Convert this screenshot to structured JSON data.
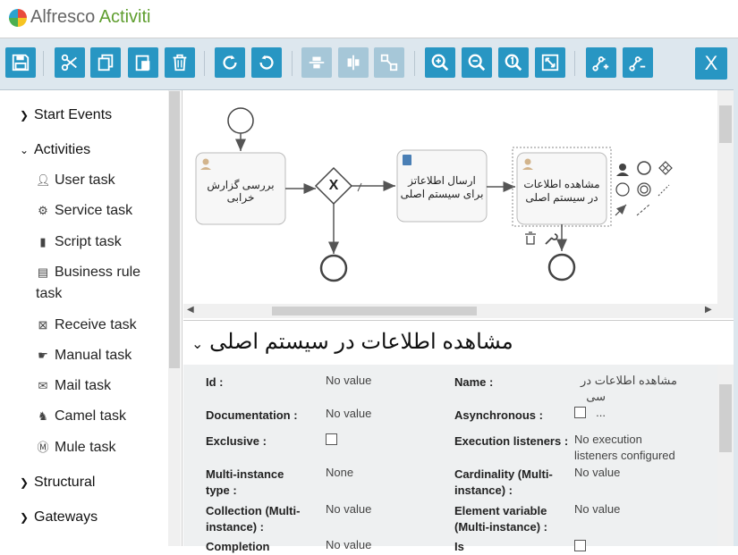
{
  "header": {
    "logo_part1": "Alfresco",
    "logo_part2": "Activiti"
  },
  "toolbar": {
    "buttons": [
      {
        "name": "save-icon",
        "enabled": true
      },
      {
        "name": "cut-icon",
        "enabled": true
      },
      {
        "name": "copy-icon",
        "enabled": true
      },
      {
        "name": "paste-icon",
        "enabled": true
      },
      {
        "name": "delete-icon",
        "enabled": true
      },
      {
        "name": "redo-icon",
        "enabled": true
      },
      {
        "name": "undo-icon",
        "enabled": true
      },
      {
        "name": "align-horizontal-icon",
        "enabled": false
      },
      {
        "name": "align-vertical-icon",
        "enabled": false
      },
      {
        "name": "same-size-icon",
        "enabled": false
      },
      {
        "name": "zoom-in-icon",
        "enabled": true
      },
      {
        "name": "zoom-out-icon",
        "enabled": true
      },
      {
        "name": "zoom-actual-icon",
        "enabled": true
      },
      {
        "name": "zoom-fit-icon",
        "enabled": true
      },
      {
        "name": "add-bendpoint-icon",
        "enabled": true
      },
      {
        "name": "remove-bendpoint-icon",
        "enabled": true
      }
    ],
    "close_label": "X"
  },
  "palette": {
    "groups": [
      {
        "label": "Start Events",
        "expanded": false
      },
      {
        "label": "Activities",
        "expanded": true
      },
      {
        "label": "Structural",
        "expanded": false
      },
      {
        "label": "Gateways",
        "expanded": false
      }
    ],
    "activities": [
      {
        "label": "User task",
        "icon": "user-icon"
      },
      {
        "label": "Service task",
        "icon": "gear-icon"
      },
      {
        "label": "Script task",
        "icon": "script-icon"
      },
      {
        "label": "Business rule",
        "label2": "task",
        "icon": "table-icon"
      },
      {
        "label": "Receive task",
        "icon": "envelope-open-icon"
      },
      {
        "label": "Manual task",
        "icon": "hand-icon"
      },
      {
        "label": "Mail task",
        "icon": "mail-icon"
      },
      {
        "label": "Camel task",
        "icon": "camel-icon"
      },
      {
        "label": "Mule task",
        "icon": "mule-icon"
      }
    ]
  },
  "diagram": {
    "task1": "بررسی گزارش خرابی",
    "task2_line1": "ارسال اطلاعاتز",
    "task2_line2": "برای سیستم اصلی",
    "task3_line1": "مشاهده اطلاعات",
    "task3_line2": "در سیستم اصلی",
    "gateway_symbol": "X"
  },
  "properties": {
    "title": "مشاهده اطلاعات در سیستم اصلی",
    "left": [
      {
        "label": "Id :",
        "value": "No value"
      },
      {
        "label": "Documentation :",
        "value": "No value"
      },
      {
        "label": "Exclusive :",
        "value": ""
      },
      {
        "label": "Multi-instance",
        "label2": "type :",
        "value": "None"
      },
      {
        "label": "Collection (Multi-",
        "label2": "instance) :",
        "value": "No value"
      },
      {
        "label": "Completion",
        "value": "No value"
      }
    ],
    "right": [
      {
        "label": "Name :",
        "value": "مشاهده اطلاعات در",
        "value2": "سی ..."
      },
      {
        "label": "Asynchronous :",
        "value": ""
      },
      {
        "label": "Execution listeners :",
        "value": "No execution",
        "value2": "listeners configured"
      },
      {
        "label": "Cardinality (Multi-",
        "label2": "instance) :",
        "value": "No value"
      },
      {
        "label": "Element variable",
        "label2": "(Multi-instance) :",
        "value": "No value"
      },
      {
        "label": "Is",
        "value": ""
      }
    ]
  },
  "colors": {
    "accent": "#2896c3",
    "accent_disabled": "#a6c7d8",
    "toolbar_bg": "#dde7ee",
    "props_bg": "#eef0f1"
  }
}
